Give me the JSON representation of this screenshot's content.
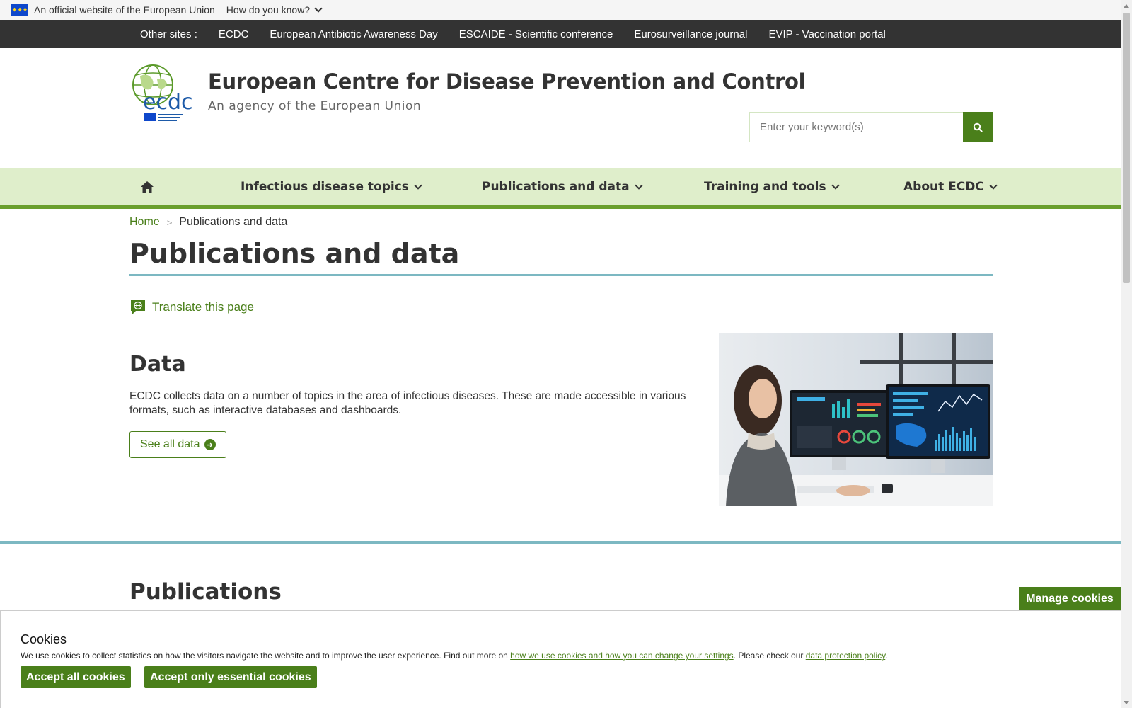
{
  "eu_banner": {
    "official_text": "An official website of the European Union",
    "how_know": "How do you know?"
  },
  "other_sites": {
    "label": "Other sites :",
    "links": [
      "ECDC",
      "European Antibiotic Awareness Day",
      "ESCAIDE - Scientific conference",
      "Eurosurveillance journal",
      "EVIP - Vaccination portal"
    ]
  },
  "header": {
    "title": "European Centre for Disease Prevention and Control",
    "subtitle": "An agency of the European Union",
    "logo_text": "ecdc",
    "search_placeholder": "Enter your keyword(s)"
  },
  "nav": {
    "items": [
      "Infectious disease topics",
      "Publications and data",
      "Training and tools",
      "About ECDC"
    ]
  },
  "breadcrumb": {
    "home": "Home",
    "separator": ">",
    "current": "Publications and data"
  },
  "page_title": "Publications and data",
  "translate_label": "Translate this page",
  "data_section": {
    "title": "Data",
    "text": "ECDC collects data on a number of topics in the area of infectious diseases. These are made accessible in various formats, such as interactive databases and dashboards.",
    "button": "See all data"
  },
  "publications_title": "Publications",
  "manage_cookies": "Manage cookies",
  "cookies": {
    "title": "Cookies",
    "text_before": "We use cookies to collect statistics on how the visitors navigate the website and to improve the user experience. Find out more on ",
    "link1": "how we use cookies and how you can change your settings",
    "text_middle": ". Please check our ",
    "link2": "data protection policy",
    "text_after": ".",
    "accept_all": "Accept all cookies",
    "accept_essential": "Accept only essential cookies"
  },
  "colors": {
    "green": "#4a7f1a",
    "nav_bg": "#dfeecb",
    "teal_rule": "#7cb8c2",
    "dark_bar": "#333333"
  }
}
